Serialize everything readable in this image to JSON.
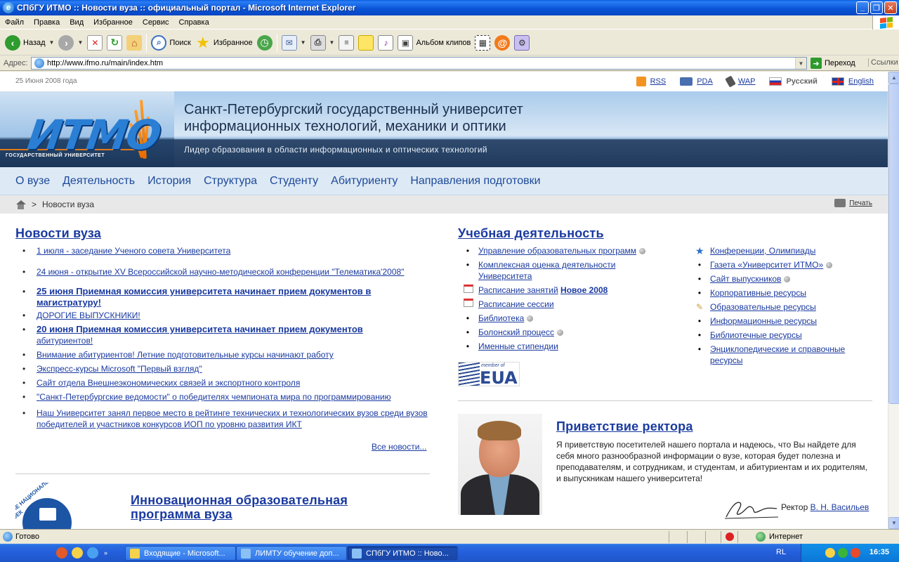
{
  "window": {
    "title": "СПбГУ ИТМО :: Новости вуза :: официальный портал - Microsoft Internet Explorer"
  },
  "menu": [
    "Файл",
    "Правка",
    "Вид",
    "Избранное",
    "Сервис",
    "Справка"
  ],
  "toolbar": {
    "back": "Назад",
    "search": "Поиск",
    "favorites": "Избранное",
    "clips": "Альбом клипов"
  },
  "address": {
    "label": "Адрес:",
    "url": "http://www.ifmo.ru/main/index.htm",
    "go": "Переход",
    "links": "Ссылки"
  },
  "page": {
    "date": "25 Июня 2008 года",
    "toplinks": {
      "rss": "RSS",
      "pda": "PDA",
      "wap": "WAP",
      "russian": "Русский",
      "english": "English"
    },
    "header": {
      "logo": "ИТМО",
      "logo_sub": "ГОСУДАРСТВЕННЫЙ УНИВЕРСИТЕТ",
      "title_line1": "Санкт-Петербургский государственный университет",
      "title_line2": "информационных технологий, механики и оптики",
      "motto": "Лидер образования в области информационных и оптических технологий"
    },
    "nav": [
      "О вузе",
      "Деятельность",
      "История",
      "Структура",
      "Студенту",
      "Абитуриенту",
      "Направления подготовки"
    ],
    "breadcrumb": {
      "separator": ">",
      "current": "Новости вуза",
      "print": "Печать"
    },
    "news": {
      "title": "Новости вуза",
      "items": [
        "1 июля - заседание Ученого совета Университета",
        "24 июня - открытие XV Всероссийской научно-методической конференции \"Телематика'2008\"",
        "25 июня Приемная комиссия университета начинает прием документов в магистратуру!",
        "ДОРОГИЕ ВЫПУСКНИКИ!",
        "20 июня Приемная комиссия университета начинает прием документов",
        "абитуриентов!",
        "Внимание абитуриентов! Летние подготовительные курсы начинают работу",
        "Экспресс-курсы Microsoft \"Первый взгляд\"",
        "Сайт отдела Внешнеэкономических связей и экспортного контроля",
        "\"Санкт-Петербургские ведомости\" о победителях чемпионата мира по программированию",
        "Наш Университет занял первое место в рейтинге технических и технологических вузов среди вузов победителей и участников конкурсов ИОП по уровню развития ИКТ"
      ],
      "all": "Все новости..."
    },
    "education": {
      "title": "Учебная деятельность",
      "items": [
        "Управление образовательных программ",
        "Комплексная оценка деятельности Университета",
        "Расписание занятий",
        "Расписание сессии",
        "Библиотека",
        "Болонский процесс",
        "Именные стипендии"
      ],
      "schedule_new": "Новое 2008",
      "eua_member": "member of",
      "eua": "EUA"
    },
    "resources": {
      "items": [
        "Конференции, Олимпиады",
        "Газета «Университет ИТМО»",
        "Сайт выпускников",
        "Корпоративные ресурсы",
        "Образовательные ресурсы",
        "Информационные ресурсы",
        "Библиотечные ресурсы",
        "Энциклопедические и справочные ресурсы"
      ]
    },
    "greeting": {
      "title": "Приветствие ректора",
      "text": "Я приветствую посетителей нашего портала и надеюсь, что Вы найдете для себя много разнообразной информации о вузе, которая будет полезна и преподавателям, и сотрудникам, и студентам, и абитуриентам и их родителям, и выпускникам нашего университета!",
      "rector_label": "Ректор",
      "rector_name": "В. Н. Васильев"
    },
    "innovation": {
      "title_line1": "Инновационная образовательная",
      "title_line2": "программа вуза",
      "logo_text": "ЕТНЫЕ НАЦИОНАЛЬНЫЕ ПРОЕК"
    }
  },
  "status": {
    "text": "Готово",
    "zone": "Интернет"
  },
  "taskbar": {
    "tasks": [
      "Входящие - Microsoft...",
      "ЛИМТУ обучение доп...",
      "СПбГУ ИТМО :: Ново..."
    ],
    "lang": "RL",
    "clock": "16:35"
  }
}
